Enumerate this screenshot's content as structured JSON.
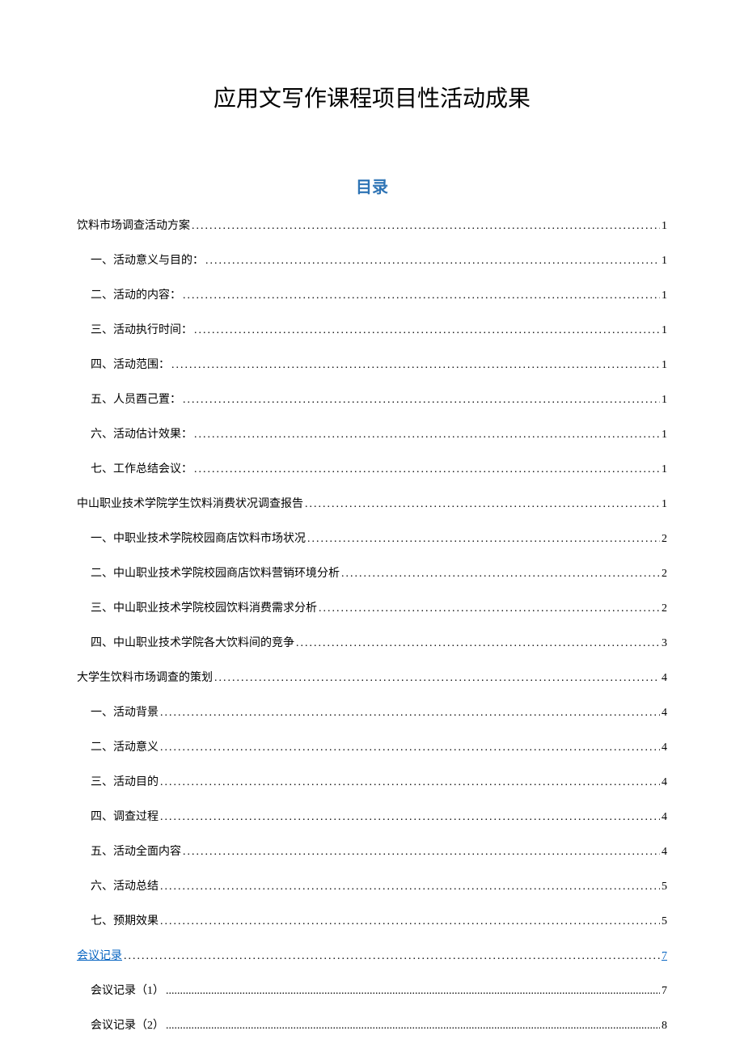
{
  "title": "应用文写作课程项目性活动成果",
  "toc_heading": "目录",
  "entries": [
    {
      "level": 1,
      "label": "饮料市场调查活动方案",
      "page": "1",
      "link": false,
      "dotted_alt": false
    },
    {
      "level": 2,
      "label": "一、活动意义与目的：",
      "page": "1",
      "link": false,
      "dotted_alt": false
    },
    {
      "level": 2,
      "label": "二、活动的内容：",
      "page": "1",
      "link": false,
      "dotted_alt": false
    },
    {
      "level": 2,
      "label": "三、活动执行时间：",
      "page": "1",
      "link": false,
      "dotted_alt": false
    },
    {
      "level": 2,
      "label": "四、活动范围：",
      "page": "1",
      "link": false,
      "dotted_alt": false
    },
    {
      "level": 2,
      "label": "五、人员酉己置：",
      "page": "1",
      "link": false,
      "dotted_alt": false
    },
    {
      "level": 2,
      "label": "六、活动估计效果：",
      "page": "1",
      "link": false,
      "dotted_alt": false
    },
    {
      "level": 2,
      "label": "七、工作总结会议：",
      "page": "1",
      "link": false,
      "dotted_alt": false
    },
    {
      "level": 1,
      "label": "中山职业技术学院学生饮料消费状况调查报告",
      "page": "1",
      "link": false,
      "dotted_alt": false
    },
    {
      "level": 2,
      "label": "一、中职业技术学院校园商店饮料市场状况",
      "page": "2",
      "link": false,
      "dotted_alt": false
    },
    {
      "level": 2,
      "label": "二、中山职业技术学院校园商店饮料营销环境分析",
      "page": "2",
      "link": false,
      "dotted_alt": false
    },
    {
      "level": 2,
      "label": "三、中山职业技术学院校园饮料消费需求分析",
      "page": "2",
      "link": false,
      "dotted_alt": false
    },
    {
      "level": 2,
      "label": "四、中山职业技术学院各大饮料间的竞争",
      "page": "3",
      "link": false,
      "dotted_alt": false
    },
    {
      "level": 1,
      "label": "大学生饮料市场调查的策划",
      "page": "4",
      "link": false,
      "dotted_alt": false
    },
    {
      "level": 2,
      "label": "一、活动背景",
      "page": "4",
      "link": false,
      "dotted_alt": false
    },
    {
      "level": 2,
      "label": "二、活动意义",
      "page": "4",
      "link": false,
      "dotted_alt": false
    },
    {
      "level": 2,
      "label": "三、活动目的",
      "page": "4",
      "link": false,
      "dotted_alt": false
    },
    {
      "level": 2,
      "label": "四、调查过程",
      "page": "4",
      "link": false,
      "dotted_alt": false
    },
    {
      "level": 2,
      "label": "五、活动全面内容",
      "page": "4",
      "link": false,
      "dotted_alt": false
    },
    {
      "level": 2,
      "label": "六、活动总结",
      "page": "5",
      "link": false,
      "dotted_alt": false
    },
    {
      "level": 2,
      "label": "七、预期效果",
      "page": "5",
      "link": false,
      "dotted_alt": false
    },
    {
      "level": 1,
      "label": "会议记录",
      "page": "7",
      "link": true,
      "dotted_alt": false
    },
    {
      "level": 2,
      "label": "会议记录（1）",
      "page": "7",
      "link": false,
      "dotted_alt": true
    },
    {
      "level": 2,
      "label": "会议记录（2）",
      "page": "8",
      "link": false,
      "dotted_alt": true
    }
  ]
}
